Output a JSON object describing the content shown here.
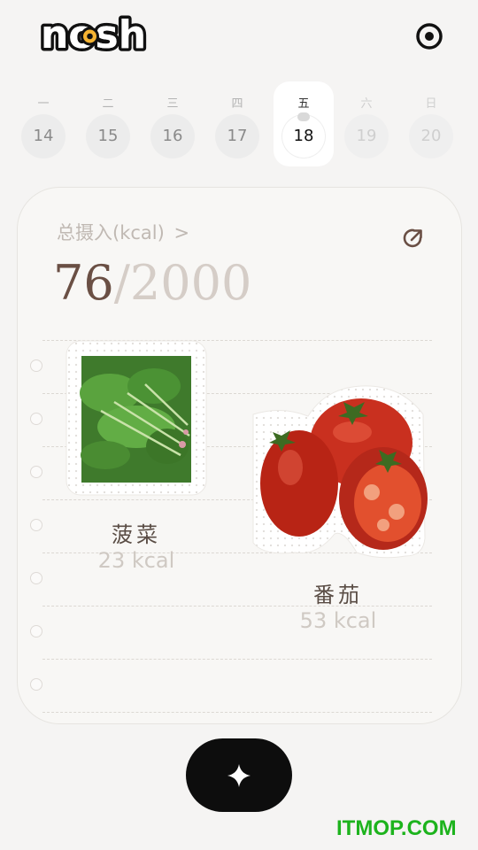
{
  "app": {
    "logo_text": "nosh"
  },
  "week": [
    {
      "weekday": "一",
      "date": "14",
      "state": "past"
    },
    {
      "weekday": "二",
      "date": "15",
      "state": "past"
    },
    {
      "weekday": "三",
      "date": "16",
      "state": "past"
    },
    {
      "weekday": "四",
      "date": "17",
      "state": "past"
    },
    {
      "weekday": "五",
      "date": "18",
      "state": "active"
    },
    {
      "weekday": "六",
      "date": "19",
      "state": "future"
    },
    {
      "weekday": "日",
      "date": "20",
      "state": "future"
    }
  ],
  "summary": {
    "label": "总摄入(kcal)",
    "chevron": ">",
    "consumed": "76",
    "separator": "/",
    "goal": "2000"
  },
  "foods": [
    {
      "name": "菠菜",
      "kcal": "23 kcal",
      "icon": "spinach-photo"
    },
    {
      "name": "番茄",
      "kcal": "53 kcal",
      "icon": "tomato-photo"
    }
  ],
  "icons": {
    "settings": "settings-icon",
    "share": "share-icon",
    "add": "add-icon"
  },
  "colors": {
    "accent_logo": "#f6b432",
    "button": "#0d0d0d",
    "text_dark": "#6a4f44",
    "text_muted": "#d5cdc7"
  },
  "watermark": "ITMOP.COM"
}
